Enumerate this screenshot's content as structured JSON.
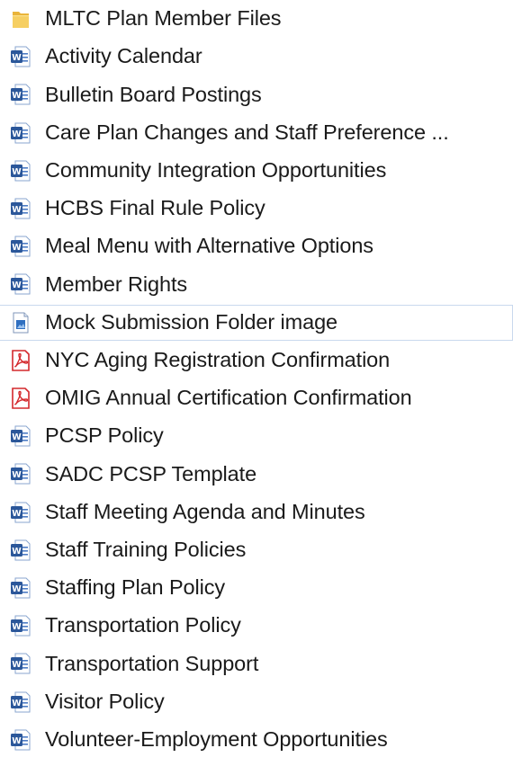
{
  "files": [
    {
      "name": "MLTC Plan Member Files",
      "type": "folder",
      "icon": "folder-icon"
    },
    {
      "name": "Activity Calendar",
      "type": "word",
      "icon": "word-document-icon"
    },
    {
      "name": "Bulletin Board Postings",
      "type": "word",
      "icon": "word-document-icon"
    },
    {
      "name": "Care Plan Changes and Staff Preference ...",
      "type": "word",
      "icon": "word-document-icon"
    },
    {
      "name": "Community Integration Opportunities",
      "type": "word",
      "icon": "word-document-icon"
    },
    {
      "name": "HCBS Final Rule Policy",
      "type": "word",
      "icon": "word-document-icon"
    },
    {
      "name": "Meal Menu with Alternative Options",
      "type": "word",
      "icon": "word-document-icon"
    },
    {
      "name": "Member Rights",
      "type": "word",
      "icon": "word-document-icon"
    },
    {
      "name": "Mock Submission Folder image",
      "type": "image",
      "icon": "image-file-icon",
      "selected": true
    },
    {
      "name": "NYC Aging Registration Confirmation",
      "type": "pdf",
      "icon": "pdf-file-icon"
    },
    {
      "name": "OMIG Annual Certification Confirmation",
      "type": "pdf",
      "icon": "pdf-file-icon"
    },
    {
      "name": "PCSP Policy",
      "type": "word",
      "icon": "word-document-icon"
    },
    {
      "name": "SADC PCSP Template",
      "type": "word",
      "icon": "word-document-icon"
    },
    {
      "name": "Staff Meeting Agenda and Minutes",
      "type": "word",
      "icon": "word-document-icon"
    },
    {
      "name": "Staff Training Policies",
      "type": "word",
      "icon": "word-document-icon"
    },
    {
      "name": "Staffing Plan Policy",
      "type": "word",
      "icon": "word-document-icon"
    },
    {
      "name": "Transportation Policy",
      "type": "word",
      "icon": "word-document-icon"
    },
    {
      "name": "Transportation Support",
      "type": "word",
      "icon": "word-document-icon"
    },
    {
      "name": "Visitor Policy",
      "type": "word",
      "icon": "word-document-icon"
    },
    {
      "name": "Volunteer-Employment Opportunities",
      "type": "word",
      "icon": "word-document-icon"
    }
  ],
  "colors": {
    "word_blue": "#2b579a",
    "pdf_red": "#d4282c",
    "folder_yellow": "#f0c24a",
    "selection_border": "#c9d9ee"
  }
}
